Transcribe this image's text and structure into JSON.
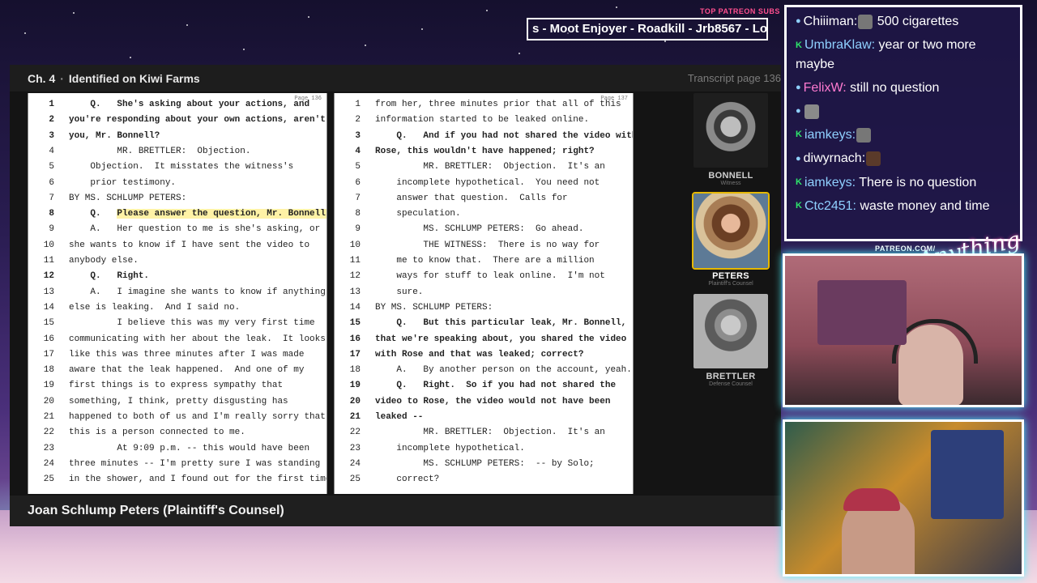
{
  "ticker": {
    "label": "TOP PATREON SUBS",
    "text": "s - Moot Enjoyer - Roadkill - Jrb8567 - Lo"
  },
  "viewer": {
    "chapter_num": "Ch. 4",
    "chapter_title": "Identified on Kiwi Farms",
    "transcript_page": "Transcript page 136",
    "caption": "Joan Schlump Peters (Plaintiff's Counsel)"
  },
  "transcript_left": {
    "page": "Page 136",
    "lines": [
      {
        "n": "1",
        "t": "    Q.   She's asking about your actions, and"
      },
      {
        "n": "2",
        "t": "you're responding about your own actions, aren't"
      },
      {
        "n": "3",
        "t": "you, Mr. Bonnell?"
      },
      {
        "n": "4",
        "t": "         MR. BRETTLER:  Objection."
      },
      {
        "n": "5",
        "t": "    Objection.  It misstates the witness's"
      },
      {
        "n": "6",
        "t": "    prior testimony."
      },
      {
        "n": "7",
        "t": "BY MS. SCHLUMP PETERS:"
      },
      {
        "n": "8",
        "t": "    Q.   Please answer the question, Mr. Bonnell."
      },
      {
        "n": "9",
        "t": "    A.   Her question to me is she's asking, or"
      },
      {
        "n": "10",
        "t": "she wants to know if I have sent the video to"
      },
      {
        "n": "11",
        "t": "anybody else."
      },
      {
        "n": "12",
        "t": "    Q.   Right."
      },
      {
        "n": "13",
        "t": "    A.   I imagine she wants to know if anything"
      },
      {
        "n": "14",
        "t": "else is leaking.  And I said no."
      },
      {
        "n": "15",
        "t": "         I believe this was my very first time"
      },
      {
        "n": "16",
        "t": "communicating with her about the leak.  It looks"
      },
      {
        "n": "17",
        "t": "like this was three minutes after I was made"
      },
      {
        "n": "18",
        "t": "aware that the leak happened.  And one of my"
      },
      {
        "n": "19",
        "t": "first things is to express sympathy that"
      },
      {
        "n": "20",
        "t": "something, I think, pretty disgusting has"
      },
      {
        "n": "21",
        "t": "happened to both of us and I'm really sorry that"
      },
      {
        "n": "22",
        "t": "this is a person connected to me."
      },
      {
        "n": "23",
        "t": "         At 9:09 p.m. -- this would have been"
      },
      {
        "n": "24",
        "t": "three minutes -- I'm pretty sure I was standing"
      },
      {
        "n": "25",
        "t": "in the shower, and I found out for the first time"
      }
    ]
  },
  "transcript_right": {
    "page": "Page 137",
    "lines": [
      {
        "n": "1",
        "t": "from her, three minutes prior that all of this"
      },
      {
        "n": "2",
        "t": "information started to be leaked online."
      },
      {
        "n": "3",
        "t": "    Q.   And if you had not shared the video with"
      },
      {
        "n": "4",
        "t": "Rose, this wouldn't have happened; right?"
      },
      {
        "n": "5",
        "t": "         MR. BRETTLER:  Objection.  It's an"
      },
      {
        "n": "6",
        "t": "    incomplete hypothetical.  You need not"
      },
      {
        "n": "7",
        "t": "    answer that question.  Calls for"
      },
      {
        "n": "8",
        "t": "    speculation."
      },
      {
        "n": "9",
        "t": "         MS. SCHLUMP PETERS:  Go ahead."
      },
      {
        "n": "10",
        "t": "         THE WITNESS:  There is no way for"
      },
      {
        "n": "11",
        "t": "    me to know that.  There are a million"
      },
      {
        "n": "12",
        "t": "    ways for stuff to leak online.  I'm not"
      },
      {
        "n": "13",
        "t": "    sure."
      },
      {
        "n": "14",
        "t": "BY MS. SCHLUMP PETERS:"
      },
      {
        "n": "15",
        "t": "    Q.   But this particular leak, Mr. Bonnell,"
      },
      {
        "n": "16",
        "t": "that we're speaking about, you shared the video"
      },
      {
        "n": "17",
        "t": "with Rose and that was leaked; correct?"
      },
      {
        "n": "18",
        "t": "    A.   By another person on the account, yeah."
      },
      {
        "n": "19",
        "t": "    Q.   Right.  So if you had not shared the"
      },
      {
        "n": "20",
        "t": "video to Rose, the video would not have been"
      },
      {
        "n": "21",
        "t": "leaked --"
      },
      {
        "n": "22",
        "t": "         MR. BRETTLER:  Objection.  It's an"
      },
      {
        "n": "23",
        "t": "    incomplete hypothetical."
      },
      {
        "n": "24",
        "t": "         MS. SCHLUMP PETERS:  -- by Solo;"
      },
      {
        "n": "25",
        "t": "    correct?"
      }
    ]
  },
  "cast": [
    {
      "name": "BONNELL",
      "role": "Witness"
    },
    {
      "name": "PETERS",
      "role": "Plaintiff's Counsel"
    },
    {
      "name": "BRETTLER",
      "role": "Defense Counsel"
    }
  ],
  "chat": [
    {
      "user": "Chiiiman",
      "color": "#ffffff",
      "text": " 500 cigarettes",
      "emote": true
    },
    {
      "user": "UmbraKlaw",
      "color": "#8fd0ff",
      "text": " year or two more maybe",
      "emote": false
    },
    {
      "user": "FelixW",
      "color": "#ff7ad0",
      "text": " still no question",
      "emote": false
    },
    {
      "user": "",
      "color": "#ffffff",
      "text": "",
      "emote": true
    },
    {
      "user": "iamkeys",
      "color": "#8fd0ff",
      "text": "",
      "emote": true
    },
    {
      "user": "diwyrnach",
      "color": "#ffffff",
      "text": "",
      "emote": true
    },
    {
      "user": "iamkeys",
      "color": "#8fd0ff",
      "text": " There is no question",
      "emote": false
    },
    {
      "user": "Ctc2451",
      "color": "#8fd0ff",
      "text": " waste money and time",
      "emote": false
    }
  ],
  "overlay": {
    "patreon": "PATREON.COM/",
    "logo": "Anything Else?"
  }
}
